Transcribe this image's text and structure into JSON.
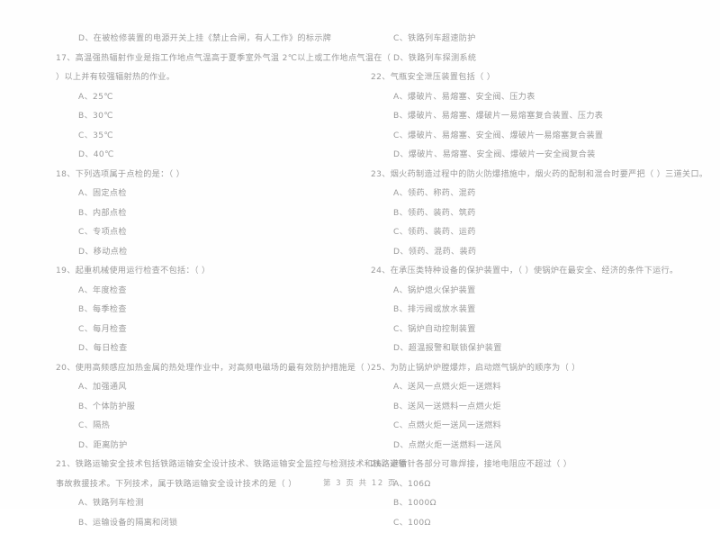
{
  "document": {
    "type": "exam-paper",
    "language": "zh-CN",
    "footer": "第 3 页 共 12 页"
  },
  "left_column": {
    "carryover_option": "D、在被检修装置的电源开关上挂《禁止合闸，有人工作》的标示牌",
    "questions": [
      {
        "number": "17",
        "stem_line1": "17、高温强热辐射作业是指工作地点气温高于夏季室外气温 2℃以上或工作地点气温在（",
        "stem_line2": "）以上并有较强辐射热的作业。",
        "options": [
          "A、25℃",
          "B、30℃",
          "C、35℃",
          "D、40℃"
        ]
      },
      {
        "number": "18",
        "stem_line1": "18、下列选项属于点检的是：（      ）",
        "stem_line2": "",
        "options": [
          "A、固定点检",
          "B、内部点检",
          "C、专项点检",
          "D、移动点检"
        ]
      },
      {
        "number": "19",
        "stem_line1": "19、起重机械使用运行检查不包括：（      ）",
        "stem_line2": "",
        "options": [
          "A、年度检查",
          "B、每季检查",
          "C、每月检查",
          "D、每日检查"
        ]
      },
      {
        "number": "20",
        "stem_line1": "20、使用高频感应加热金属的热处理作业中，对高频电磁场的最有效防护措施是（      ）",
        "stem_line2": "",
        "options": [
          "A、加强通风",
          "B、个体防护服",
          "C、隔热",
          "D、距离防护"
        ]
      },
      {
        "number": "21",
        "stem_line1": "21、铁路运输安全技术包括铁路运输安全设计技术、铁路运输安全监控与检测技术和铁路运输",
        "stem_line2": "事故救援技术。下列技术，属于铁路运输安全设计技术的是（      ）",
        "options": [
          "A、铁路列车检测",
          "B、运输设备的隔离和闭锁"
        ]
      }
    ]
  },
  "right_column": {
    "carryover_options": [
      "C、铁路列车超速防护",
      "D、铁路列车探测系统"
    ],
    "questions": [
      {
        "number": "22",
        "stem_line1": "22、气瓶安全泄压装置包括（      ）",
        "stem_line2": "",
        "options": [
          "A、爆破片、易熔塞、安全阀、压力表",
          "B、爆破片、易熔塞、爆破片一易熔塞复合装置、压力表",
          "C、爆破片、易熔塞、安全阀、爆破片一易熔塞复合装置",
          "D、爆破片、易熔塞、安全阀、爆破片一安全阀复合装"
        ]
      },
      {
        "number": "23",
        "stem_line1": "23、烟火药制造过程中的防火防爆措施中，烟火药的配制和混合时要严把（      ）三道关口。",
        "stem_line2": "",
        "options": [
          "A、领药、称药、混药",
          "B、领药、装药、筑药",
          "C、领药、装药、运药",
          "D、领药、混药、装药"
        ]
      },
      {
        "number": "24",
        "stem_line1": "24、在承压类特种设备的保护装置中，（      ）使锅炉在最安全、经济的条件下运行。",
        "stem_line2": "",
        "options": [
          "A、锅炉熄火保护装置",
          "B、排污阀或放水装置",
          "C、锅炉自动控制装置",
          "D、超温报警和联锁保护装置"
        ]
      },
      {
        "number": "25",
        "stem_line1": "25、为防止锅炉炉膛爆炸，启动燃气锅炉的顺序为（      ）",
        "stem_line2": "",
        "options": [
          "A、送风一点燃火炬一送燃料",
          "B、送风一送燃料一点燃火炬",
          "C、点燃火炬一送风一送燃料",
          "D、点燃火炬一送燃料一送风"
        ]
      },
      {
        "number": "26",
        "stem_line1": "26、避雷针各部分可靠焊接，接地电阻应不超过（      ）",
        "stem_line2": "",
        "options": [
          "A、106Ω",
          "B、1000Ω",
          "C、100Ω"
        ]
      }
    ]
  }
}
